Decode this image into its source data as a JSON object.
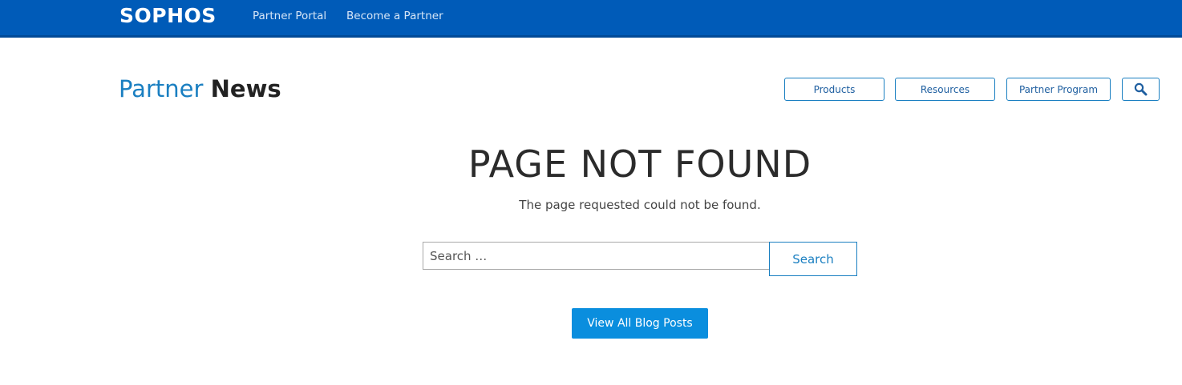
{
  "header": {
    "logo": "SOPHOS",
    "links": [
      "Partner Portal",
      "Become a Partner"
    ]
  },
  "brand": {
    "part1": "Partner",
    "part2": "News"
  },
  "nav": {
    "items": [
      "Products",
      "Resources",
      "Partner Program"
    ],
    "search_icon": "search-icon"
  },
  "main": {
    "title": "PAGE NOT FOUND",
    "message": "The page requested could not be found.",
    "search": {
      "placeholder": "Search …",
      "button": "Search"
    },
    "view_all": "View All Blog Posts"
  },
  "colors": {
    "header_bg": "#005bb8",
    "accent": "#1a7fc1",
    "button_bg": "#0a8ede"
  }
}
